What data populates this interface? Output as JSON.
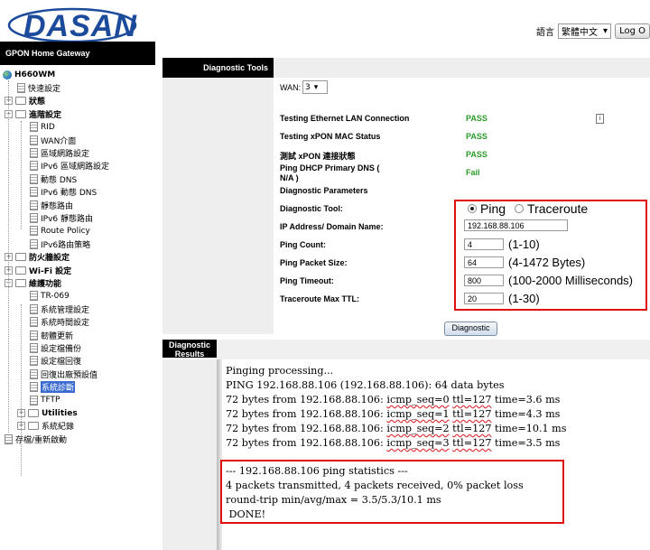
{
  "header": {
    "logo_text": "DASAN",
    "lang_label": "語言",
    "lang_value": "繁體中文",
    "logout_label": "Log O"
  },
  "sidebar": {
    "title": "GPON Home Gateway",
    "root": "H660WM",
    "items": [
      {
        "label": "快速設定",
        "type": "doc",
        "level": 1
      },
      {
        "label": "狀態",
        "type": "folder",
        "level": 0,
        "bold": true
      },
      {
        "label": "進階設定",
        "type": "folder",
        "level": 0,
        "bold": true
      },
      {
        "label": "RID",
        "type": "doc",
        "level": 2
      },
      {
        "label": "WAN介面",
        "type": "doc",
        "level": 2
      },
      {
        "label": "區域網路設定",
        "type": "doc",
        "level": 2
      },
      {
        "label": "IPv6 區域網路設定",
        "type": "doc",
        "level": 2
      },
      {
        "label": "動態 DNS",
        "type": "doc",
        "level": 2
      },
      {
        "label": "IPv6 動態 DNS",
        "type": "doc",
        "level": 2
      },
      {
        "label": "靜態路由",
        "type": "doc",
        "level": 2
      },
      {
        "label": "IPv6 靜態路由",
        "type": "doc",
        "level": 2
      },
      {
        "label": "Route Policy",
        "type": "doc",
        "level": 2
      },
      {
        "label": "IPv6路由策略",
        "type": "doc",
        "level": 2
      },
      {
        "label": "防火牆設定",
        "type": "folder",
        "level": 0,
        "bold": true
      },
      {
        "label": "Wi-Fi 設定",
        "type": "folder",
        "level": 0,
        "bold": true
      },
      {
        "label": "維護功能",
        "type": "folder",
        "level": 0,
        "bold": true
      },
      {
        "label": "TR-069",
        "type": "doc",
        "level": 2
      },
      {
        "label": "系統管理設定",
        "type": "doc",
        "level": 2
      },
      {
        "label": "系統時間設定",
        "type": "doc",
        "level": 2
      },
      {
        "label": "韌體更新",
        "type": "doc",
        "level": 2
      },
      {
        "label": "設定檔備份",
        "type": "doc",
        "level": 2
      },
      {
        "label": "設定檔回復",
        "type": "doc",
        "level": 2
      },
      {
        "label": "回復出廠預設值",
        "type": "doc",
        "level": 2
      },
      {
        "label": "系統診斷",
        "type": "doc",
        "level": 2,
        "selected": true
      },
      {
        "label": "TFTP",
        "type": "doc",
        "level": 2
      },
      {
        "label": "Utilities",
        "type": "folder",
        "level": 1,
        "bold": true
      },
      {
        "label": "系統紀錄",
        "type": "folder",
        "level": 1
      },
      {
        "label": "存檔/重新啟動",
        "type": "doc",
        "level": 0
      }
    ]
  },
  "diag_tools": {
    "title": "Diagnostic Tools",
    "wan_label": "WAN:",
    "wan_value": "3",
    "tests": [
      {
        "label": "Testing Ethernet LAN Connection",
        "result": "PASS"
      },
      {
        "label": "Testing xPON MAC Status",
        "result": "PASS"
      },
      {
        "label": "測試 xPON 連接狀態",
        "result": "PASS"
      },
      {
        "label": "Ping DHCP Primary DNS ( N/A )",
        "result": "Fail"
      }
    ],
    "params_label": "Diagnostic Parameters",
    "tool_label": "Diagnostic Tool:",
    "tool_options": [
      "Ping",
      "Traceroute"
    ],
    "ip_label": "IP Address/ Domain Name:",
    "ip_value": "192.168.88.106",
    "count_label": "Ping Count:",
    "count_value": "4",
    "count_unit": "(1-10)",
    "size_label": "Ping Packet Size:",
    "size_value": "64",
    "size_unit": "(4-1472 Bytes)",
    "timeout_label": "Ping Timeout:",
    "timeout_value": "800",
    "timeout_unit": "(100-2000 Milliseconds)",
    "ttl_label": "Traceroute Max TTL:",
    "ttl_value": "20",
    "ttl_unit": "(1-30)",
    "button_label": "Diagnostic"
  },
  "diag_results": {
    "title_line1": "Diagnostic",
    "title_line2": "Results",
    "processing": "Pinging processing...",
    "ping_header": "PING 192.168.88.106 (192.168.88.106): 64 data bytes",
    "replies": [
      {
        "prefix": "72 bytes from 192.168.88.106: ",
        "seq": "icmp_seq=0",
        "ttl": "ttl=127",
        "time": " time=3.6 ms"
      },
      {
        "prefix": "72 bytes from 192.168.88.106: ",
        "seq": "icmp_seq=1",
        "ttl": "ttl=127",
        "time": " time=4.3 ms"
      },
      {
        "prefix": "72 bytes from 192.168.88.106: ",
        "seq": "icmp_seq=2",
        "ttl": "ttl=127",
        "time": " time=10.1 ms"
      },
      {
        "prefix": "72 bytes from 192.168.88.106: ",
        "seq": "icmp_seq=3",
        "ttl": "ttl=127",
        "time": " time=3.5 ms"
      }
    ],
    "stats_header": "--- 192.168.88.106 ping statistics ---",
    "stats_packets": "4 packets transmitted, 4 packets received, 0% packet loss",
    "stats_rtt": "round-trip min/avg/max = 3.5/5.3/10.1 ms",
    "done": " DONE!"
  },
  "colors": {
    "pass": "#2a9a2a",
    "highlight": "#e01010",
    "selected": "#3a6bd0"
  }
}
